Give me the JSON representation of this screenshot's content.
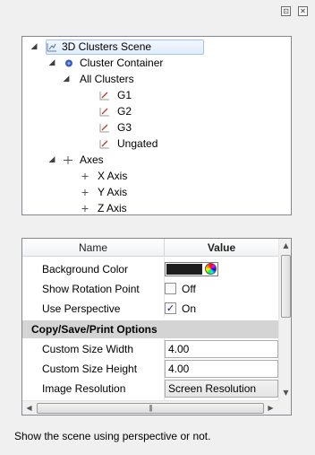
{
  "window_controls": {
    "pin_glyph": "⊡",
    "close_glyph": "✕"
  },
  "tree": {
    "items": [
      {
        "label": "3D Clusters Scene",
        "expander": "◢",
        "icon": "scene-icon",
        "selected": true
      },
      {
        "label": "Cluster Container",
        "expander": "◢",
        "icon": "container-icon"
      },
      {
        "label": "All Clusters",
        "expander": "◢",
        "icon": ""
      },
      {
        "label": "G1",
        "expander": "",
        "icon": "gate-icon"
      },
      {
        "label": "G2",
        "expander": "",
        "icon": "gate-icon"
      },
      {
        "label": "G3",
        "expander": "",
        "icon": "gate-icon"
      },
      {
        "label": "Ungated",
        "expander": "",
        "icon": "gate-icon"
      },
      {
        "label": "Axes",
        "expander": "◢",
        "icon": "axes-icon"
      },
      {
        "label": "X Axis",
        "expander": "",
        "icon": "axis-icon"
      },
      {
        "label": "Y Axis",
        "expander": "",
        "icon": "axis-icon"
      },
      {
        "label": "Z Axis",
        "expander": "",
        "icon": "axis-icon"
      }
    ]
  },
  "grid": {
    "header": {
      "name": "Name",
      "value": "Value"
    },
    "rows": {
      "background_color": {
        "name": "Background Color",
        "color": "#1e1e1e"
      },
      "show_rotation_point": {
        "name": "Show Rotation Point",
        "checked": false,
        "state": "Off"
      },
      "use_perspective": {
        "name": "Use Perspective",
        "checked": true,
        "state": "On",
        "check_glyph": "✓"
      },
      "category": {
        "name": "Copy/Save/Print Options"
      },
      "custom_size_width": {
        "name": "Custom Size Width",
        "value": "4.00"
      },
      "custom_size_height": {
        "name": "Custom Size Height",
        "value": "4.00"
      },
      "image_resolution": {
        "name": "Image Resolution",
        "value": "Screen Resolution"
      }
    },
    "scroll": {
      "up": "▲",
      "down": "▼",
      "left": "◀",
      "right": "▶",
      "grip": "|||"
    }
  },
  "description": "Show the scene using perspective or not.",
  "colors": {
    "selection_bg": "#e0ecfb",
    "selection_border": "#a3c5ec",
    "category_bg": "#d4d4d4",
    "gate_icon": "#c0392b"
  }
}
